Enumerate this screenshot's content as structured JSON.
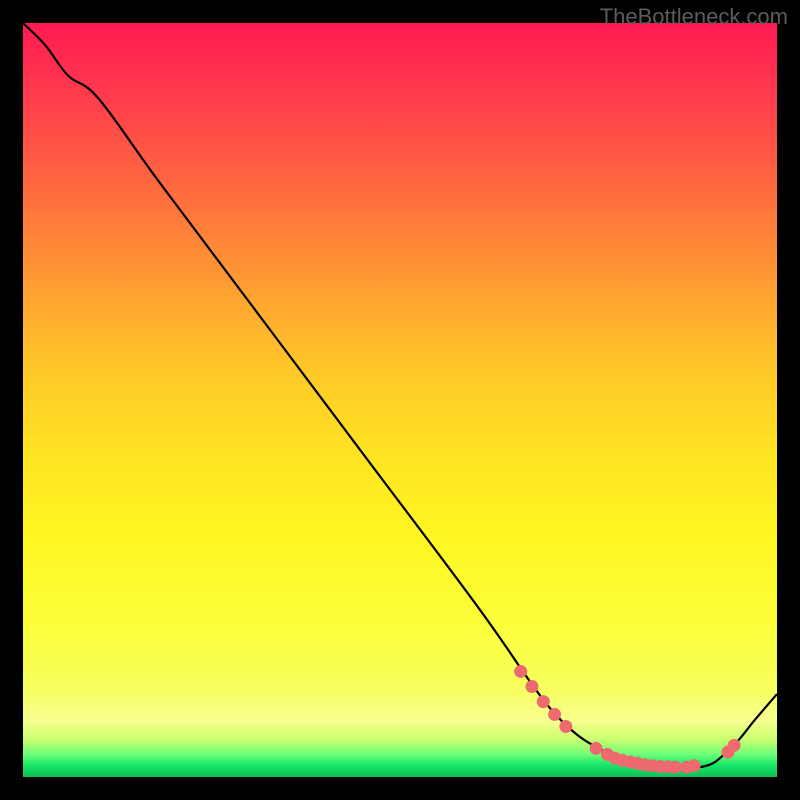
{
  "watermark": "TheBottleneck.com",
  "chart_data": {
    "type": "line",
    "title": "",
    "xlabel": "",
    "ylabel": "",
    "x_range": [
      0,
      100
    ],
    "y_range": [
      0,
      100
    ],
    "series": [
      {
        "name": "curve",
        "x": [
          0,
          3,
          6,
          10,
          18,
          30,
          45,
          60,
          67,
          70,
          73,
          76,
          80,
          84,
          88,
          91,
          93,
          95,
          97,
          100
        ],
        "y": [
          100,
          97,
          93,
          90,
          79,
          63,
          43,
          23,
          13,
          9,
          6,
          4,
          2.2,
          1.4,
          1.2,
          1.6,
          3,
          5,
          7.5,
          11
        ]
      }
    ],
    "scatter_points": {
      "name": "highlight-dots",
      "points": [
        {
          "x": 66,
          "y": 14.0
        },
        {
          "x": 67.5,
          "y": 12.0
        },
        {
          "x": 69,
          "y": 10.0
        },
        {
          "x": 70.5,
          "y": 8.3
        },
        {
          "x": 72,
          "y": 6.7
        },
        {
          "x": 76,
          "y": 3.8
        },
        {
          "x": 77.5,
          "y": 3.0
        },
        {
          "x": 78.5,
          "y": 2.5
        },
        {
          "x": 79.5,
          "y": 2.2
        },
        {
          "x": 80.5,
          "y": 2.0
        },
        {
          "x": 81.5,
          "y": 1.8
        },
        {
          "x": 82.5,
          "y": 1.6
        },
        {
          "x": 83.5,
          "y": 1.5
        },
        {
          "x": 84.5,
          "y": 1.4
        },
        {
          "x": 85.5,
          "y": 1.35
        },
        {
          "x": 86.5,
          "y": 1.3
        },
        {
          "x": 88,
          "y": 1.3
        },
        {
          "x": 89,
          "y": 1.5
        },
        {
          "x": 93.5,
          "y": 3.3
        },
        {
          "x": 94.3,
          "y": 4.2
        }
      ]
    }
  }
}
